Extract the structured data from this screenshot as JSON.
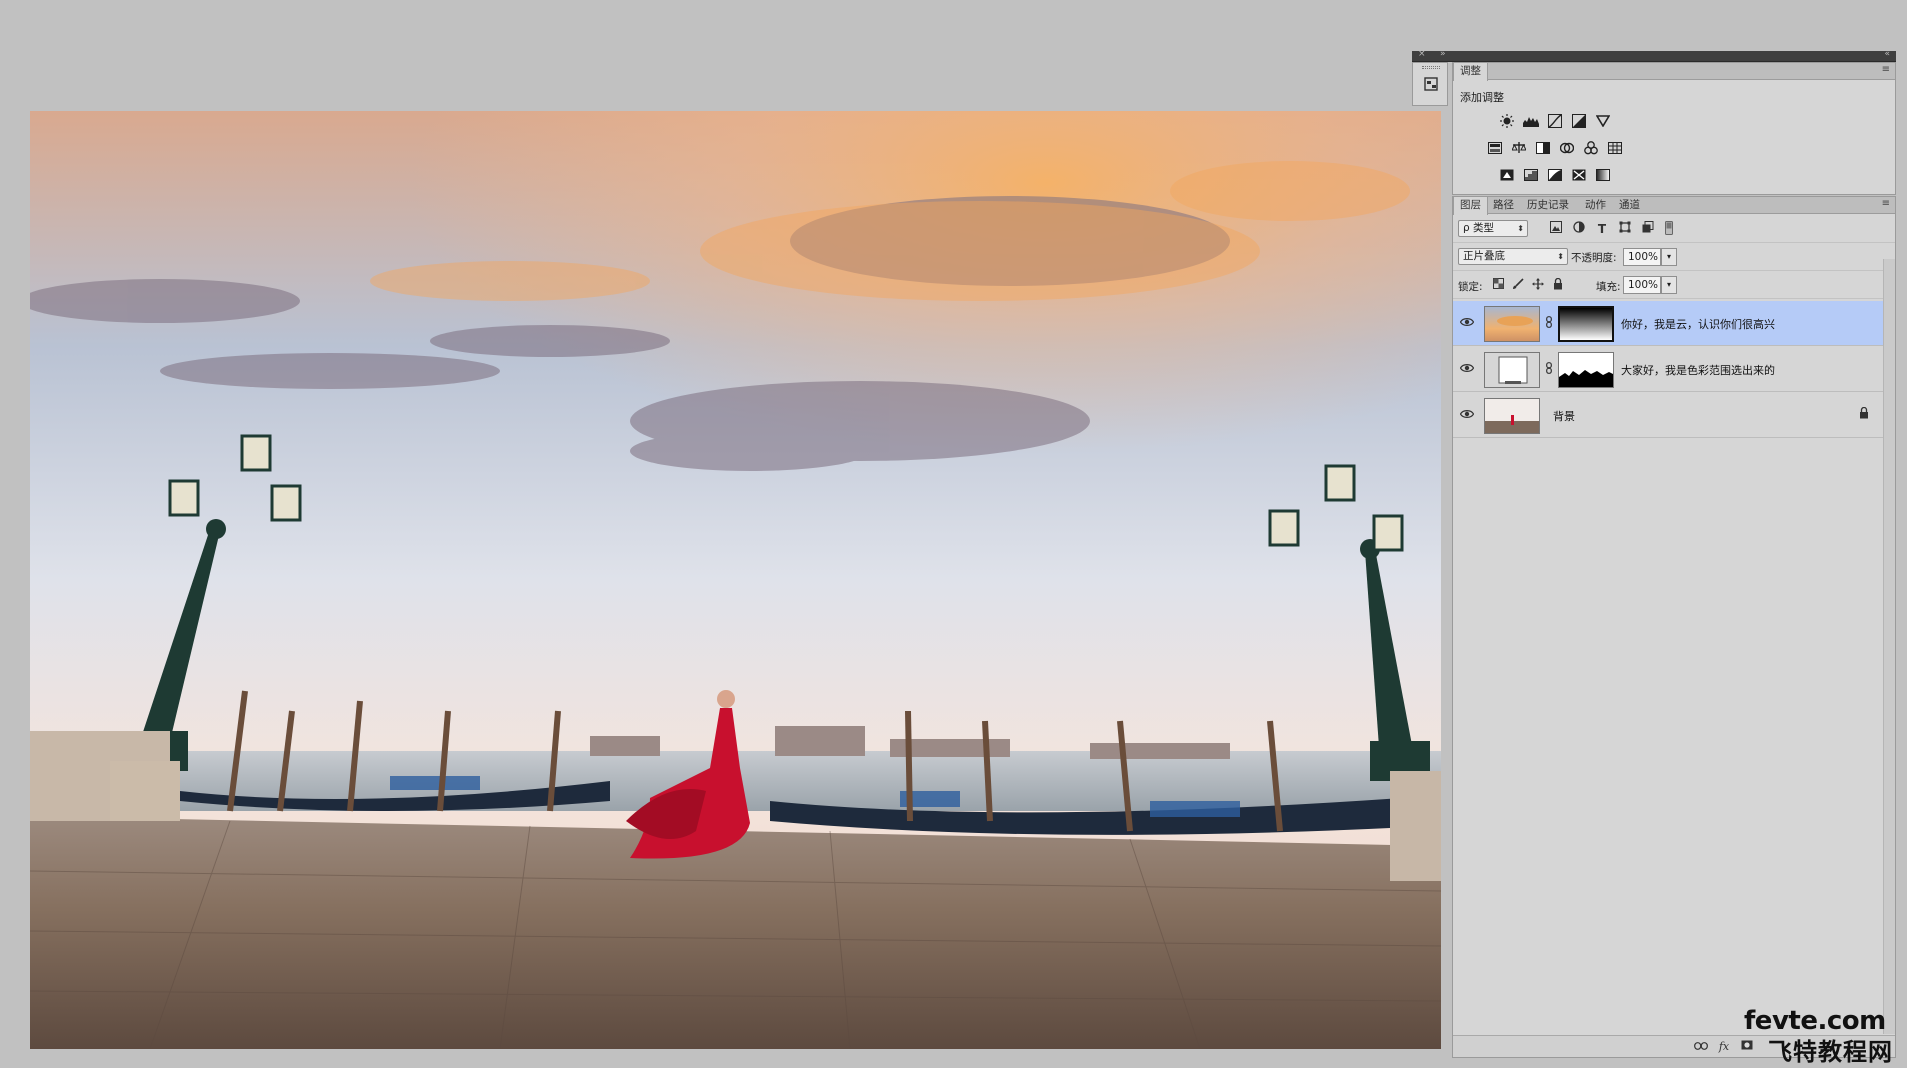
{
  "dock": {
    "close_glyph": "×",
    "collapse_glyph": "»",
    "menu_glyph": "«"
  },
  "tool_strip": {
    "icon": "adjustments-panel-icon"
  },
  "adjustments": {
    "tabs": [
      "调整"
    ],
    "menu_glyph": "≡",
    "title": "添加调整",
    "rows": [
      [
        "brightness-contrast-icon",
        "levels-icon",
        "curves-icon",
        "exposure-icon",
        "vibrance-icon"
      ],
      [
        "hue-saturation-icon",
        "color-balance-icon",
        "black-white-icon",
        "photo-filter-icon",
        "channel-mixer-icon",
        "color-lookup-icon"
      ],
      [
        "invert-icon",
        "posterize-icon",
        "threshold-icon",
        "selective-color-icon",
        "gradient-map-icon"
      ]
    ]
  },
  "layers_panel": {
    "tabs": [
      "图层",
      "路径",
      "历史记录",
      "动作",
      "通道"
    ],
    "menu_glyph": "≡",
    "filter_select": "ρ 类型",
    "blend_mode": "正片叠底",
    "opacity_label": "不透明度:",
    "opacity_value": "100%",
    "lock_label": "锁定:",
    "fill_label": "填充:",
    "fill_value": "100%",
    "layers": [
      {
        "name": "你好，我是云，认识你们很高兴",
        "selected": true,
        "has_mask": true,
        "locked": false
      },
      {
        "name": "大家好，我是色彩范围选出来的",
        "selected": false,
        "has_mask": true,
        "locked": false
      },
      {
        "name": "背景",
        "selected": false,
        "has_mask": false,
        "locked": true
      }
    ]
  },
  "watermark": {
    "line1": "fevte.com",
    "line2": "飞特教程网"
  },
  "colors": {
    "selected_layer": "#b5cbf7",
    "panel_bg": "#d6d6d6",
    "workspace_bg": "#c1c1c1"
  }
}
